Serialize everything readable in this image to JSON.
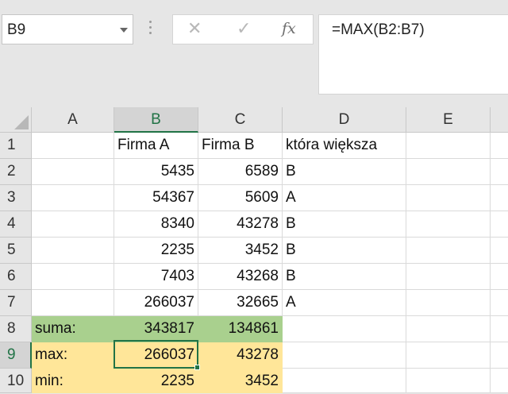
{
  "name_box": {
    "value": "B9"
  },
  "formula_bar": {
    "cancel": "✕",
    "enter": "✓",
    "fx": "fx",
    "formula": "=MAX(B2:B7)"
  },
  "columns": [
    "A",
    "B",
    "C",
    "D",
    "E"
  ],
  "rows": [
    {
      "num": "1",
      "A": "",
      "B": "Firma A",
      "C": "Firma B",
      "D": "która większa"
    },
    {
      "num": "2",
      "A": "",
      "B": "5435",
      "C": "6589",
      "D": "B"
    },
    {
      "num": "3",
      "A": "",
      "B": "54367",
      "C": "5609",
      "D": "A"
    },
    {
      "num": "4",
      "A": "",
      "B": "8340",
      "C": "43278",
      "D": "B"
    },
    {
      "num": "5",
      "A": "",
      "B": "2235",
      "C": "3452",
      "D": "B"
    },
    {
      "num": "6",
      "A": "",
      "B": "7403",
      "C": "43268",
      "D": "B"
    },
    {
      "num": "7",
      "A": "",
      "B": "266037",
      "C": "32665",
      "D": "A"
    },
    {
      "num": "8",
      "A": "suma:",
      "B": "343817",
      "C": "134861",
      "D": ""
    },
    {
      "num": "9",
      "A": "max:",
      "B": "266037",
      "C": "43278",
      "D": ""
    },
    {
      "num": "10",
      "A": "min:",
      "B": "2235",
      "C": "3452",
      "D": ""
    }
  ],
  "colors": {
    "selection": "#217346",
    "sum_fill": "#a9d08e",
    "stats_fill": "#ffe699"
  }
}
